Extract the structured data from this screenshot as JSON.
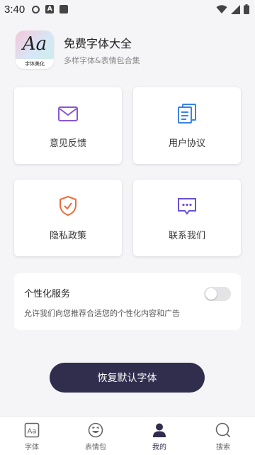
{
  "status_bar": {
    "time": "3:40"
  },
  "header": {
    "logo_text": "Aa",
    "logo_caption": "字体美化",
    "title": "免费字体大全",
    "subtitle": "多样字体&表情包合集"
  },
  "cards": [
    {
      "label": "意见反馈",
      "icon": "mail-icon",
      "color": "#8a56d6"
    },
    {
      "label": "用户协议",
      "icon": "document-icon",
      "color": "#3b82e6"
    },
    {
      "label": "隐私政策",
      "icon": "shield-check-icon",
      "color": "#f06a3a"
    },
    {
      "label": "联系我们",
      "icon": "chat-icon",
      "color": "#6a4fd6"
    }
  ],
  "service": {
    "title": "个性化服务",
    "description": "允许我们向您推荐合适您的个性化内容和广告",
    "enabled": false
  },
  "restore_button": {
    "label": "恢复默认字体"
  },
  "bottom_nav": {
    "active": "我的",
    "items": [
      {
        "label": "字体",
        "icon": "font-icon"
      },
      {
        "label": "表情包",
        "icon": "emoji-icon"
      },
      {
        "label": "我的",
        "icon": "person-icon"
      },
      {
        "label": "搜索",
        "icon": "search-icon"
      }
    ]
  },
  "colors": {
    "accent": "#302d4d",
    "background": "#f5f5f7"
  }
}
